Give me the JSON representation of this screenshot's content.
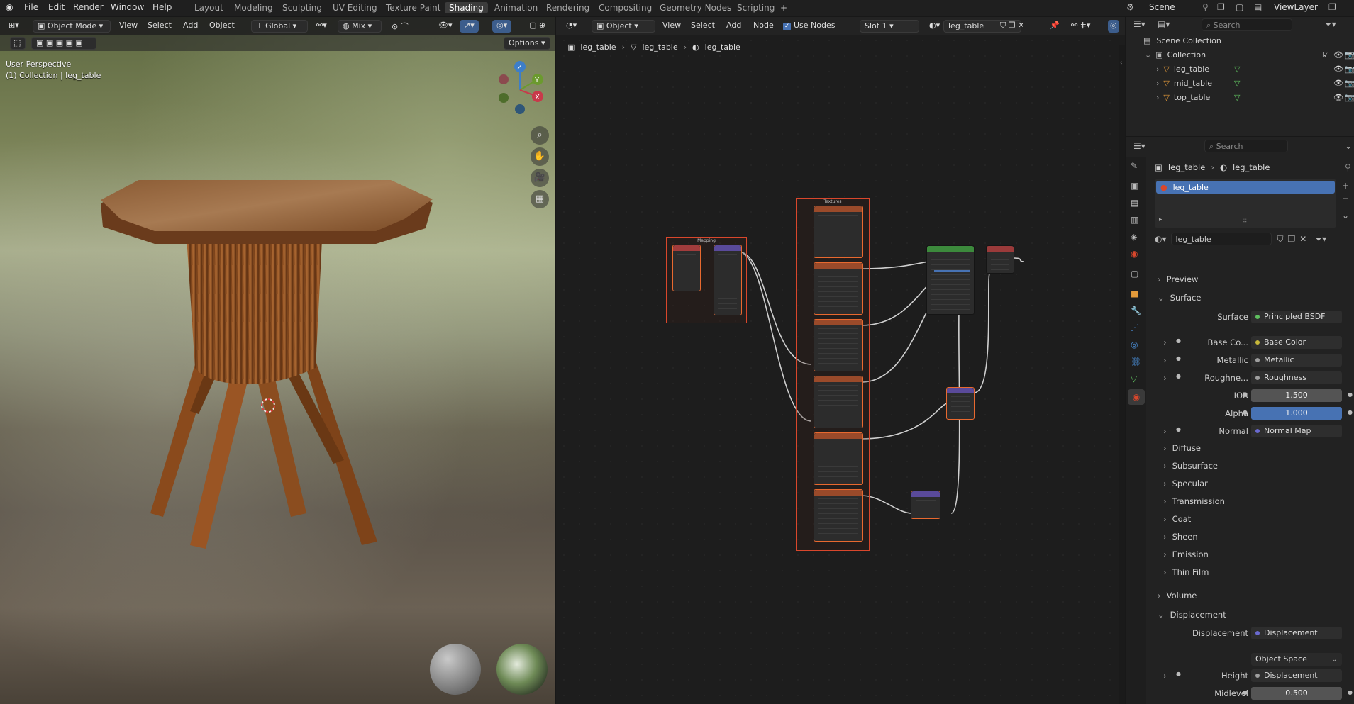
{
  "topbar": {
    "menus": [
      "File",
      "Edit",
      "Render",
      "Window",
      "Help"
    ],
    "workspaces": [
      "Layout",
      "Modeling",
      "Sculpting",
      "UV Editing",
      "Texture Paint",
      "Shading",
      "Animation",
      "Rendering",
      "Compositing",
      "Geometry Nodes",
      "Scripting"
    ],
    "active_workspace": "Shading",
    "add_tab": "+",
    "scene": "Scene",
    "view_layer": "ViewLayer"
  },
  "viewport": {
    "mode": "Object Mode",
    "menus": [
      "View",
      "Select",
      "Add",
      "Object"
    ],
    "orientation": "Global",
    "pivot": "Mix",
    "options_label": "Options",
    "overlay_title": "User Perspective",
    "overlay_subtitle": "(1) Collection | leg_table",
    "gizmo": {
      "z": "Z",
      "y": "Y",
      "x": "X"
    }
  },
  "node_editor": {
    "object_dropdown": "Object",
    "menus": [
      "View",
      "Select",
      "Add",
      "Node"
    ],
    "use_nodes_label": "Use Nodes",
    "slot": "Slot 1",
    "material": "leg_table",
    "breadcrumb": [
      "leg_table",
      "leg_table",
      "leg_table"
    ],
    "frame_titles": [
      "Mapping",
      "Textures"
    ]
  },
  "outliner": {
    "search_placeholder": "Search",
    "scene_collection": "Scene Collection",
    "collection": "Collection",
    "objects": [
      "leg_table",
      "mid_table",
      "top_table"
    ]
  },
  "properties": {
    "search_placeholder": "Search",
    "breadcrumb": [
      "leg_table",
      "leg_table"
    ],
    "slot_name": "leg_table",
    "material_name": "leg_table",
    "sections": {
      "preview": "Preview",
      "surface": "Surface",
      "volume": "Volume",
      "displacement": "Displacement"
    },
    "surface_label": "Surface",
    "surface_value": "Principled BSDF",
    "inputs": [
      {
        "label": "Base Co...",
        "value": "Base Color",
        "color": "#c7b83a"
      },
      {
        "label": "Metallic",
        "value": "Metallic",
        "color": "#9f9f9f"
      },
      {
        "label": "Roughne...",
        "value": "Roughness",
        "color": "#9f9f9f"
      }
    ],
    "ior_label": "IOR",
    "ior_value": "1.500",
    "alpha_label": "Alpha",
    "alpha_value": "1.000",
    "normal_label": "Normal",
    "normal_value": "Normal Map",
    "subpanels": [
      "Diffuse",
      "Subsurface",
      "Specular",
      "Transmission",
      "Coat",
      "Sheen",
      "Emission",
      "Thin Film"
    ],
    "displacement_label": "Displacement",
    "displacement_value": "Displacement",
    "space_value": "Object Space",
    "height_label": "Height",
    "height_value": "Displacement",
    "midlevel_label": "Midlevel",
    "midlevel_value": "0.500"
  },
  "colors": {
    "accent": "#4772b3",
    "node_border": "#d9472c",
    "active_tab": "#3c3c3c"
  }
}
